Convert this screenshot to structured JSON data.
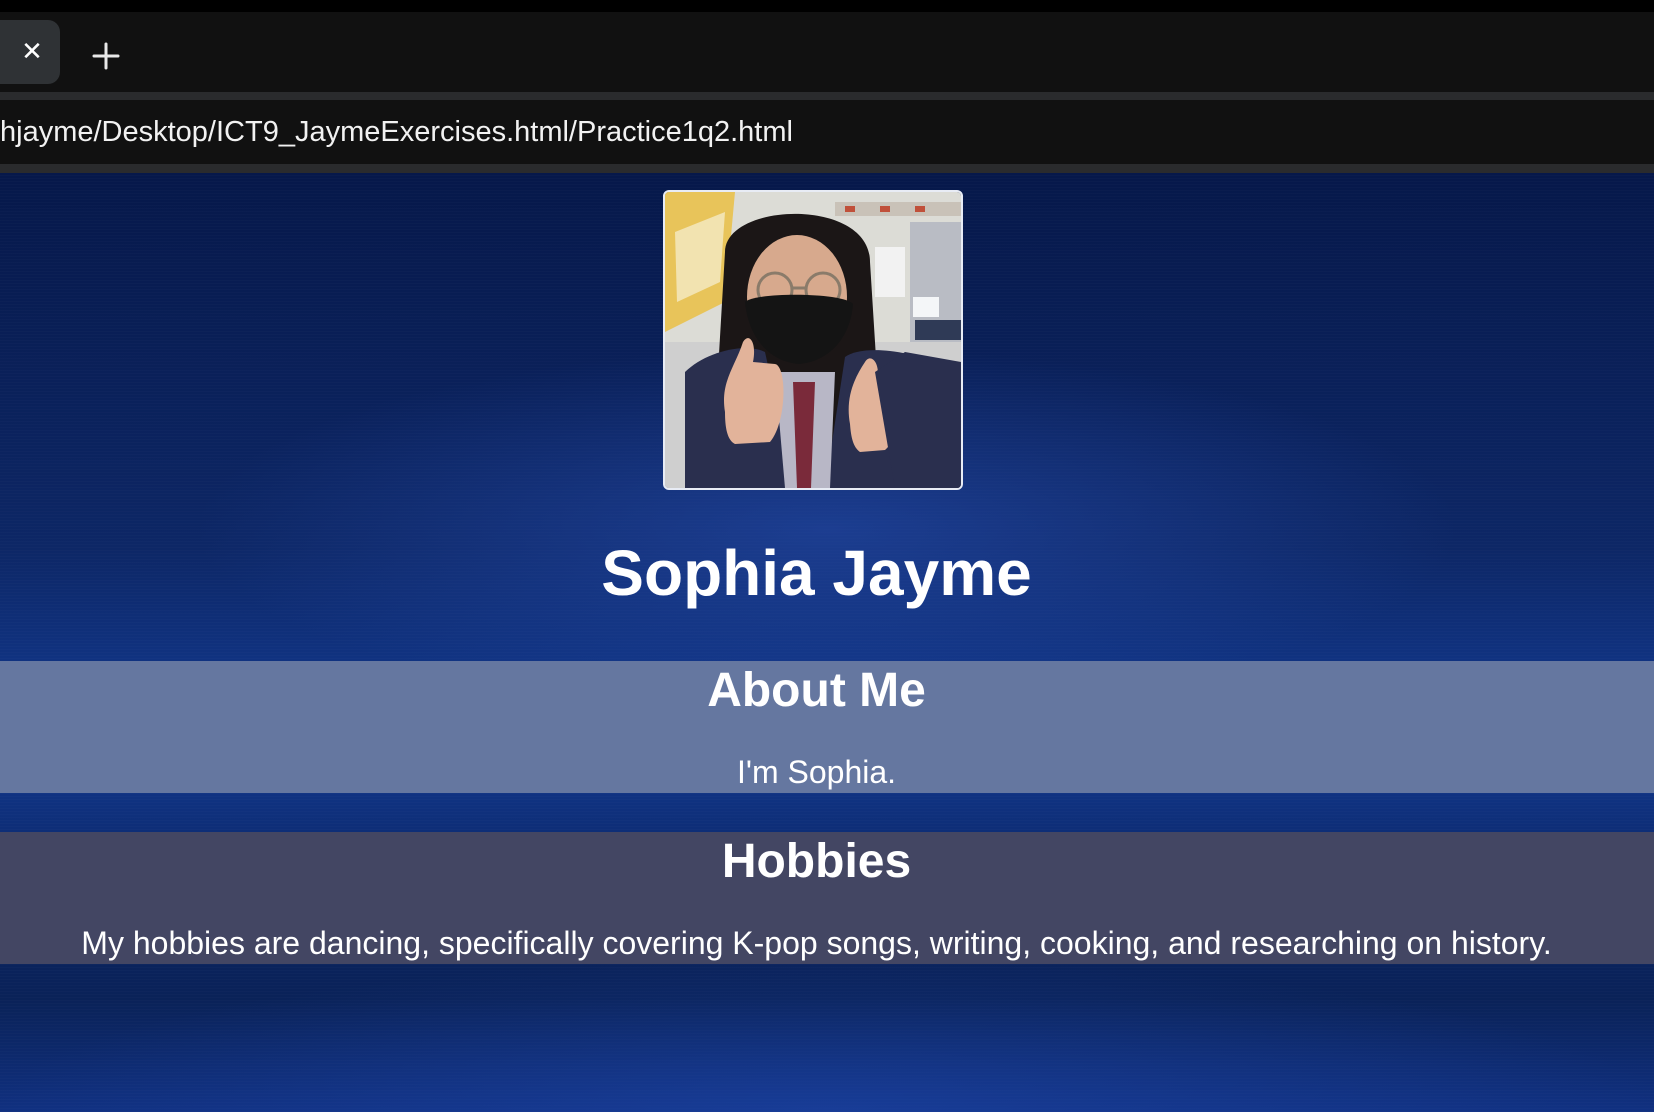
{
  "browser": {
    "tab_close_glyph": "✕",
    "new_tab_icon": "plus-icon",
    "address": "hjayme/Desktop/ICT9_JaymeExercises.html/Practice1q2.html"
  },
  "profile": {
    "photo_icon": "profile-photo",
    "name": "Sophia Jayme"
  },
  "about": {
    "heading": "About Me",
    "text": "I'm Sophia."
  },
  "hobbies": {
    "heading": "Hobbies",
    "text": "My hobbies are dancing, specifically covering K-pop songs, writing, cooking, and researching on history."
  },
  "colors": {
    "page_background": "#0c1f55",
    "about_band": "#6577a0",
    "hobbies_band": "#434663",
    "text": "#ffffff"
  }
}
